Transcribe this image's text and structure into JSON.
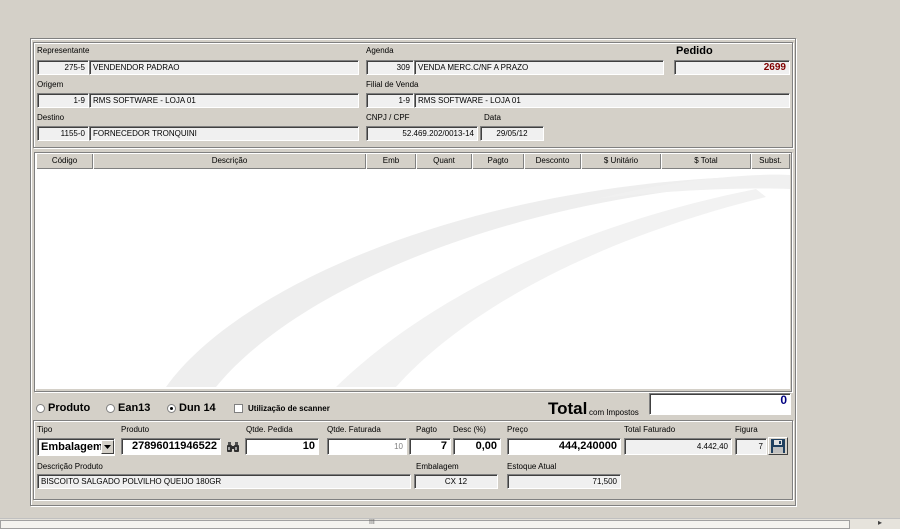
{
  "header": {
    "representante": {
      "label": "Representante",
      "code": "275-5",
      "name": "VENDENDOR PADRAO"
    },
    "agenda": {
      "label": "Agenda",
      "code": "309",
      "name": "VENDA MERC.C/NF A PRAZO"
    },
    "pedido": {
      "label": "Pedido",
      "value": "2699"
    },
    "origem": {
      "label": "Origem",
      "code": "1-9",
      "name": "RMS SOFTWARE - LOJA 01"
    },
    "filial": {
      "label": "Filial de Venda",
      "code": "1-9",
      "name": "RMS SOFTWARE - LOJA 01"
    },
    "destino": {
      "label": "Destino",
      "code": "1155-0",
      "name": "FORNECEDOR TRONQUINI"
    },
    "cnpj": {
      "label": "CNPJ / CPF",
      "value": "52.469.202/0013-14"
    },
    "data": {
      "label": "Data",
      "value": "29/05/12"
    }
  },
  "grid": {
    "columns": [
      "Código",
      "Descrição",
      "Emb",
      "Quant",
      "Pagto",
      "Desconto",
      "$ Unitário",
      "$ Total",
      "Subst."
    ]
  },
  "options": {
    "produto": "Produto",
    "ean13": "Ean13",
    "dun14": "Dun 14",
    "scanner": "Utilização de scanner",
    "selected": "Dun 14"
  },
  "total": {
    "label": "Total",
    "sublabel": "com Impostos",
    "value": "0"
  },
  "item": {
    "tipo": {
      "label": "Tipo",
      "value": "Embalagem"
    },
    "produto": {
      "label": "Produto",
      "value": "27896011946522"
    },
    "qtde_pedida": {
      "label": "Qtde. Pedida",
      "value": "10"
    },
    "qtde_faturada": {
      "label": "Qtde. Faturada",
      "value": "10"
    },
    "pagto": {
      "label": "Pagto",
      "value": "7"
    },
    "desc": {
      "label": "Desc (%)",
      "value": "0,00"
    },
    "preco": {
      "label": "Preço",
      "value": "444,240000"
    },
    "total_faturado": {
      "label": "Total Faturado",
      "value": "4.442,40"
    },
    "figura": {
      "label": "Figura",
      "value": "7"
    },
    "descricao": {
      "label": "Descrição Produto",
      "value": "BISCOITO SALGADO POLVILHO QUEIJO 180GR"
    },
    "embalagem": {
      "label": "Embalagem",
      "value": "CX  12"
    },
    "estoque": {
      "label": "Estoque Atual",
      "value": "71,500"
    }
  },
  "scrollbar": {
    "grip": "III",
    "arrow": "▸"
  },
  "colors": {
    "pedido_value": "#800000",
    "total_value": "#000080",
    "background": "#d4d0c8"
  }
}
